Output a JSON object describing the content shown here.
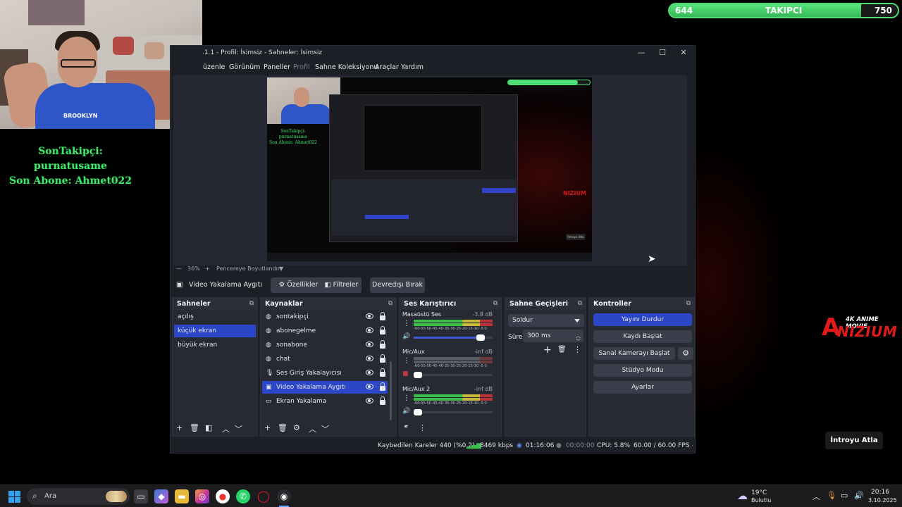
{
  "overlay": {
    "follow_line1": "SonTakipçi: purnatusame",
    "follow_line2": "Son Abone: Ahmet022",
    "follower_bar": {
      "min": "644",
      "label": "TAKIPCI",
      "max": "750",
      "progress": 0.84,
      "color": "#4cde74"
    },
    "logo_sub": "4K ANIME MOVIE",
    "logo_main": "NIZIUM",
    "logo_a": "A",
    "skip_button": "İntroyu Atla",
    "webcam_shirt": "BROOKLYN"
  },
  "preview_mini": {
    "follow_line1": "SonTakipçi: purnatusame",
    "follow_line2": "Son Abone: Ahmet022",
    "logo": "NIZIUM",
    "skip": "İntroyu Atla"
  },
  "obs": {
    "title": ".1.1 - Profil: İsimsiz - Sahneler: İsimsiz",
    "window_buttons": {
      "minimize": "—",
      "maximize": "☐",
      "close": "✕"
    },
    "menu": [
      "üzenle",
      "Görünüm",
      "Paneller",
      "Profil",
      "Sahne Koleksiyonu",
      "Araçlar",
      "Yardım"
    ],
    "zoom": {
      "minus": "—",
      "value": "36%",
      "plus": "+",
      "mode": "Pencereye Boyutlandır",
      "arrow": "▼"
    },
    "toolbar": {
      "source_name": "Video Yakalama Aygıtı",
      "properties": "Özellikler",
      "filters": "Filtreler",
      "deactivate": "Devredışı Bırak"
    },
    "scenes": {
      "title": "Sahneler",
      "items": [
        "açılış",
        "küçük ekran",
        "büyük ekran"
      ],
      "selected": 1
    },
    "sources": {
      "title": "Kaynaklar",
      "items": [
        {
          "label": "sontakipçi",
          "icon": "globe-icon",
          "glyph": "◍"
        },
        {
          "label": "abonegelme",
          "icon": "globe-icon",
          "glyph": "◍"
        },
        {
          "label": "sonabone",
          "icon": "globe-icon",
          "glyph": "◍"
        },
        {
          "label": "chat",
          "icon": "globe-icon",
          "glyph": "◍"
        },
        {
          "label": "Ses Giriş Yakalayıcısı",
          "icon": "microphone-icon",
          "glyph": "🎙"
        },
        {
          "label": "Video Yakalama Aygıtı",
          "icon": "camera-icon",
          "glyph": "▣"
        },
        {
          "label": "Ekran Yakalama",
          "icon": "monitor-icon",
          "glyph": "▭"
        }
      ],
      "selected": 5
    },
    "mixer": {
      "title": "Ses Karıştırıcı",
      "scale": "-60-55-50-45-40-35-30-25-20-15-10 -5  0",
      "channels": [
        {
          "name": "Masaüstü Ses",
          "db": "-3.8 dB",
          "active": true,
          "muted": false,
          "volume": 0.85
        },
        {
          "name": "Mic/Aux",
          "db": "-inf dB",
          "active": false,
          "muted": true,
          "volume": 0.05
        },
        {
          "name": "Mic/Aux 2",
          "db": "-inf dB",
          "active": true,
          "muted": false,
          "volume": 0.05
        }
      ]
    },
    "transitions": {
      "title": "Sahne Geçişleri",
      "type": "Soldur",
      "duration_label": "Süre",
      "duration": "300 ms"
    },
    "controls": {
      "title": "Kontroller",
      "stop_stream": "Yayını Durdur",
      "start_recording": "Kaydı Başlat",
      "virtual_camera": "Sanal Kamerayı Başlat",
      "studio_mode": "Stüdyo Modu",
      "settings": "Ayarlar"
    },
    "status": {
      "dropped_frames": "Kaybedilen Kareler 440 (%0.2)",
      "bitrate": "8469 kbps",
      "stream_time": "01:16:06",
      "rec_time": "00:00:00",
      "cpu": "CPU: 5.8%",
      "fps": "60.00 / 60.00 FPS"
    },
    "accent_color": "#2b46c7"
  },
  "taskbar": {
    "search_placeholder": "Ara",
    "weather_temp": "19°C",
    "weather_desc": "Bulutlu",
    "time": "20:16",
    "date": "3.10.2025"
  }
}
